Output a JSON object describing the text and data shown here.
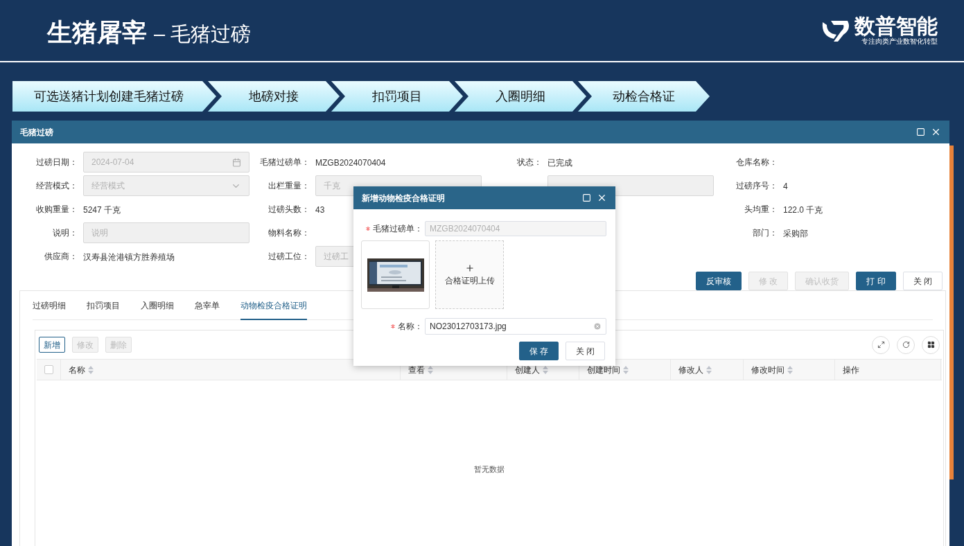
{
  "slide": {
    "title_bold": "生猪屠宰",
    "title_rest": "– 毛猪过磅",
    "logo": {
      "name": "数普智能",
      "tagline": "专注肉类产业数智化转型"
    }
  },
  "steps": [
    {
      "label": "可选送猪计划创建毛猪过磅"
    },
    {
      "label": "地磅对接"
    },
    {
      "label": "扣罚项目"
    },
    {
      "label": "入圈明细"
    },
    {
      "label": "动检合格证"
    }
  ],
  "window": {
    "title": "毛猪过磅"
  },
  "form": {
    "rows": [
      [
        {
          "label": "过磅日期：",
          "kind": "date",
          "value": "2024-07-04",
          "disabled": true
        },
        {
          "label": "毛猪过磅单：",
          "kind": "text",
          "value": "MZGB2024070404"
        },
        {
          "label": "状态：",
          "kind": "text",
          "value": "已完成"
        },
        {
          "label": "仓库名称：",
          "kind": "text"
        }
      ],
      [
        {
          "label": "经营模式：",
          "kind": "select",
          "placeholder": "经营模式",
          "disabled": true
        },
        {
          "label": "出栏重量：",
          "kind": "input",
          "placeholder": "千克",
          "disabled": true
        },
        {
          "kind": "input",
          "disabled": true
        },
        {
          "label": "过磅序号：",
          "kind": "text",
          "value": "4"
        }
      ],
      [
        {
          "label": "收购重量：",
          "kind": "text",
          "value": "5247 千克"
        },
        {
          "label": "过磅头数：",
          "kind": "text",
          "value": "43"
        },
        {
          "kind": "blank"
        },
        {
          "label": "头均重：",
          "kind": "text",
          "value": "122.0 千克"
        }
      ],
      [
        {
          "label": "说明：",
          "kind": "input",
          "placeholder": "说明",
          "disabled": true
        },
        {
          "label": "物料名称：",
          "kind": "text"
        },
        {
          "kind": "blank"
        },
        {
          "label": "部门：",
          "kind": "text",
          "value": "采购部"
        }
      ],
      [
        {
          "label": "供应商：",
          "kind": "text",
          "value": "汉寿县沧港镇方胜养殖场"
        },
        {
          "label": "过磅工位：",
          "kind": "input",
          "placeholder": "过磅工",
          "disabled": true
        },
        {
          "kind": "blank"
        },
        {
          "kind": "blank"
        }
      ]
    ]
  },
  "actions": [
    {
      "label": "反审核",
      "kind": "primary",
      "disabled": false
    },
    {
      "label": "修 改",
      "kind": "default",
      "disabled": true
    },
    {
      "label": "确认收货",
      "kind": "default",
      "disabled": true
    },
    {
      "label": "打 印",
      "kind": "primary",
      "disabled": false
    },
    {
      "label": "关 闭",
      "kind": "default",
      "disabled": false
    }
  ],
  "tabs": [
    {
      "label": "过磅明细",
      "selected": false
    },
    {
      "label": "扣罚项目",
      "selected": false
    },
    {
      "label": "入圈明细",
      "selected": false
    },
    {
      "label": "急宰单",
      "selected": false
    },
    {
      "label": "动物检疫合格证明",
      "selected": true
    }
  ],
  "toolbar": [
    {
      "label": "新增",
      "disabled": false
    },
    {
      "label": "修改",
      "disabled": true
    },
    {
      "label": "删除",
      "disabled": true
    }
  ],
  "table": {
    "columns": [
      {
        "label": "名称",
        "sortable": true
      },
      {
        "label": "查看",
        "sortable": true
      },
      {
        "label": "创建人",
        "sortable": true
      },
      {
        "label": "创建时间",
        "sortable": true
      },
      {
        "label": "修改人",
        "sortable": true
      },
      {
        "label": "修改时间",
        "sortable": true
      },
      {
        "label": "操作",
        "sortable": false
      }
    ],
    "select_all_checked": false,
    "empty_text": "暂无数据"
  },
  "dialog": {
    "title": "新增动物检疫合格证明",
    "order": {
      "label": "毛猪过磅单：",
      "required": true,
      "value": "MZGB2024070404",
      "disabled": true
    },
    "upload_label": "合格证明上传",
    "name": {
      "label": "名称：",
      "required": true,
      "value": "NO23012703173.jpg"
    },
    "buttons": [
      {
        "label": "保 存",
        "kind": "primary"
      },
      {
        "label": "关 闭",
        "kind": "default"
      }
    ]
  }
}
